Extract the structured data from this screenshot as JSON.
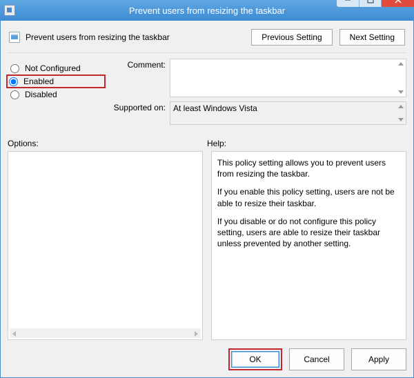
{
  "window": {
    "title": "Prevent users from resizing the taskbar"
  },
  "header": {
    "policy_title": "Prevent users from resizing the taskbar",
    "previous_setting": "Previous Setting",
    "next_setting": "Next Setting"
  },
  "state": {
    "not_configured": "Not Configured",
    "enabled": "Enabled",
    "disabled": "Disabled",
    "selected": "enabled"
  },
  "labels": {
    "comment": "Comment:",
    "supported": "Supported on:",
    "options": "Options:",
    "help": "Help:"
  },
  "values": {
    "comment": "",
    "supported": "At least Windows Vista"
  },
  "help": {
    "p1": "This policy setting allows you to prevent users from resizing the taskbar.",
    "p2": "If you enable this policy setting, users are not be able to resize their taskbar.",
    "p3": "If you disable or do not configure this policy setting, users are able to resize their taskbar unless prevented by another setting."
  },
  "footer": {
    "ok": "OK",
    "cancel": "Cancel",
    "apply": "Apply"
  }
}
